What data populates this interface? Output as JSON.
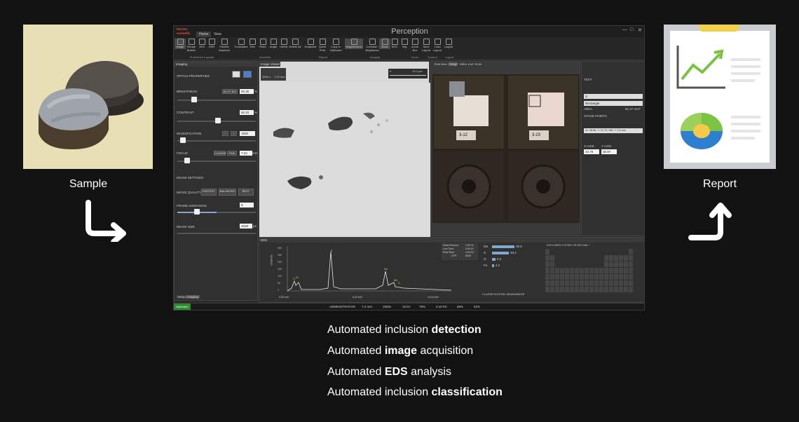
{
  "left_label": "Sample",
  "right_label": "Report",
  "app": {
    "title": "Perception",
    "brand": "thermo scientific",
    "tabs": [
      "Home",
      "View"
    ],
    "ribbon_buttons": [
      "Image",
      "Recipe Builder",
      "AFA",
      "GSR",
      "Particle Inspector",
      "Crosshairs",
      "Text",
      "Ruler",
      "Angle",
      "Delete",
      "Delete All",
      "Snapshot",
      "Quick Print",
      "Copy to Clipboard",
      "Magnification",
      "Contrast / Brightness",
      "Blank",
      "EDS",
      "Img",
      "Zoom Box",
      "Save Layout",
      "Load Layout",
      "Logout"
    ],
    "ribbon_groups": [
      "Predefined Layouts",
      "Annotate",
      "Report",
      "Imaging",
      "Zoom",
      "Custom",
      "Logout"
    ],
    "imaging_panel": {
      "title": "Imaging",
      "optics": "OPTICS PROPERTIES",
      "brightness_label": "BRIGHTNESS",
      "brightness_btn": "AUTO B/C",
      "brightness_value": "50.30",
      "brightness_unit": "%",
      "contrast_label": "CONTRAST",
      "contrast_value": "50.22",
      "contrast_unit": "%",
      "magnification_label": "MAGNIFICATION",
      "magnification_value": "1500",
      "focus_label": "FOCUS",
      "focus_btn1": "COARSE",
      "focus_btn2": "FINE",
      "focus_value": "7.22",
      "focus_unit": "mm",
      "image_settings": "IMAGE SETTINGS",
      "quality_label": "IMAGE QUALITY",
      "quality_options": [
        "FASTEST",
        "BALANCED",
        "BEST"
      ],
      "frame_label": "FRAME AVERAGING",
      "frame_value": "8",
      "size_label": "IMAGE SIZE",
      "size_value": "2048",
      "size_unit": "px",
      "footer_tabs": [
        "Setup",
        "Imaging"
      ]
    },
    "image_viewer": {
      "tab": "Image Viewer",
      "mag": "1500 x",
      "hfw": "7.22 mm",
      "scale": "13.2 µm",
      "scale_zero": "0"
    },
    "nav_tabs": [
      "Overview",
      "Stage",
      "Video Live Scan"
    ],
    "stage_labels": [
      "3-12",
      "3-23"
    ],
    "right_panel": {
      "text_section": "TEXT",
      "shape": "Rectangle",
      "area_label": "AREA",
      "area_value": "81.27 mm²",
      "stage_points": "STAGE POINTS",
      "point_value": "(X: 28.56, Y: 21.72, WD: 7.17) mm",
      "x_axis": "X-AXIS",
      "y_axis": "Y-AXIS",
      "x_value": "24.76 mm",
      "y_value": "30.87 mm"
    },
    "eds_panel": {
      "title": "EDS",
      "dead_percent_label": "Dead Percent",
      "dead_percent_value": "2.93 %",
      "live_time_label": "Live Time",
      "live_time_value": "0:00:01",
      "real_time_label": "Real Time",
      "real_time_value": "0:00:01",
      "cps_label": "CPS",
      "cps_value": "8349",
      "y_axis": "COUNTS",
      "x_ticks": [
        "0.00 keV",
        "5.00 keV",
        "10.00 keV"
      ],
      "y_ticks": [
        "300",
        "250",
        "200",
        "150",
        "100",
        "50",
        "0"
      ],
      "peak_labels": [
        "S",
        "Mn",
        "Mn",
        "Fe",
        "O",
        "S"
      ],
      "classification": "CLASSIFICATION: MANGANESE",
      "elements": [
        {
          "name": "Mn",
          "value": "49.6"
        },
        {
          "name": "S",
          "value": "38.2"
        },
        {
          "name": "O",
          "value": "8.0"
        },
        {
          "name": "Fe",
          "value": "4.2"
        }
      ],
      "explorer": "EXPLORER 4 STEEL 25 KEV.XML *"
    },
    "status": {
      "imaging": "IMAGING",
      "user": "ADMINISTRATOR",
      "hfw": "7.2 mm",
      "mag": "1500x",
      "kv": "15 kV",
      "focus": "79%",
      "current": "0.10 Pa",
      "brightness": "58%",
      "contrast": "52%"
    }
  },
  "captions": [
    {
      "pre": "Automated inclusion ",
      "bold": "detection",
      "post": ""
    },
    {
      "pre": "Automated ",
      "bold": "image",
      "post": " acquisition"
    },
    {
      "pre": "Automated ",
      "bold": "EDS",
      "post": " analysis"
    },
    {
      "pre": "Automated inclusion ",
      "bold": "classification",
      "post": ""
    }
  ],
  "colors": {
    "background": "#121212",
    "accent_green": "#2e8b2e",
    "chart_green": "#7cc243",
    "chart_blue": "#3b8fd9",
    "sample_bg": "#e8dfb4"
  }
}
